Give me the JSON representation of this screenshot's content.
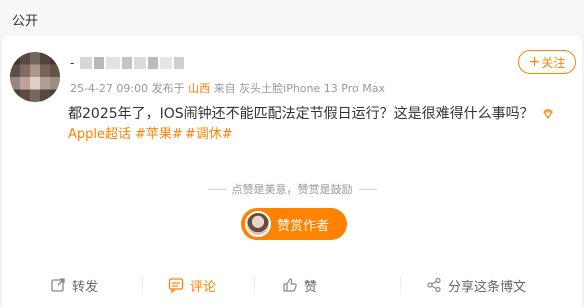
{
  "header": {
    "visibility": "公开"
  },
  "post": {
    "username_prefix": "-",
    "meta": {
      "timestamp": "25-4-27 09:00",
      "posted_in_label": "发布于",
      "location": "山西",
      "from_label": "来自",
      "device": "灰头土脸iPhone 13 Pro Max"
    },
    "follow_label": "关注",
    "text": "都2025年了，IOS闹钟还不能匹配法定节假日运行？这是很难得什么事吗？",
    "topics": [
      "Apple超话",
      "#苹果#",
      "#调休#"
    ],
    "tip_hint": "点赞是美意，赞赏是鼓励",
    "tip_button": "赞赏作者"
  },
  "actions": {
    "repost": "转发",
    "comment": "评论",
    "like": "赞",
    "share": "分享这条博文"
  },
  "colors": {
    "accent": "#ff8200",
    "text": "#333333",
    "muted": "#999999"
  }
}
